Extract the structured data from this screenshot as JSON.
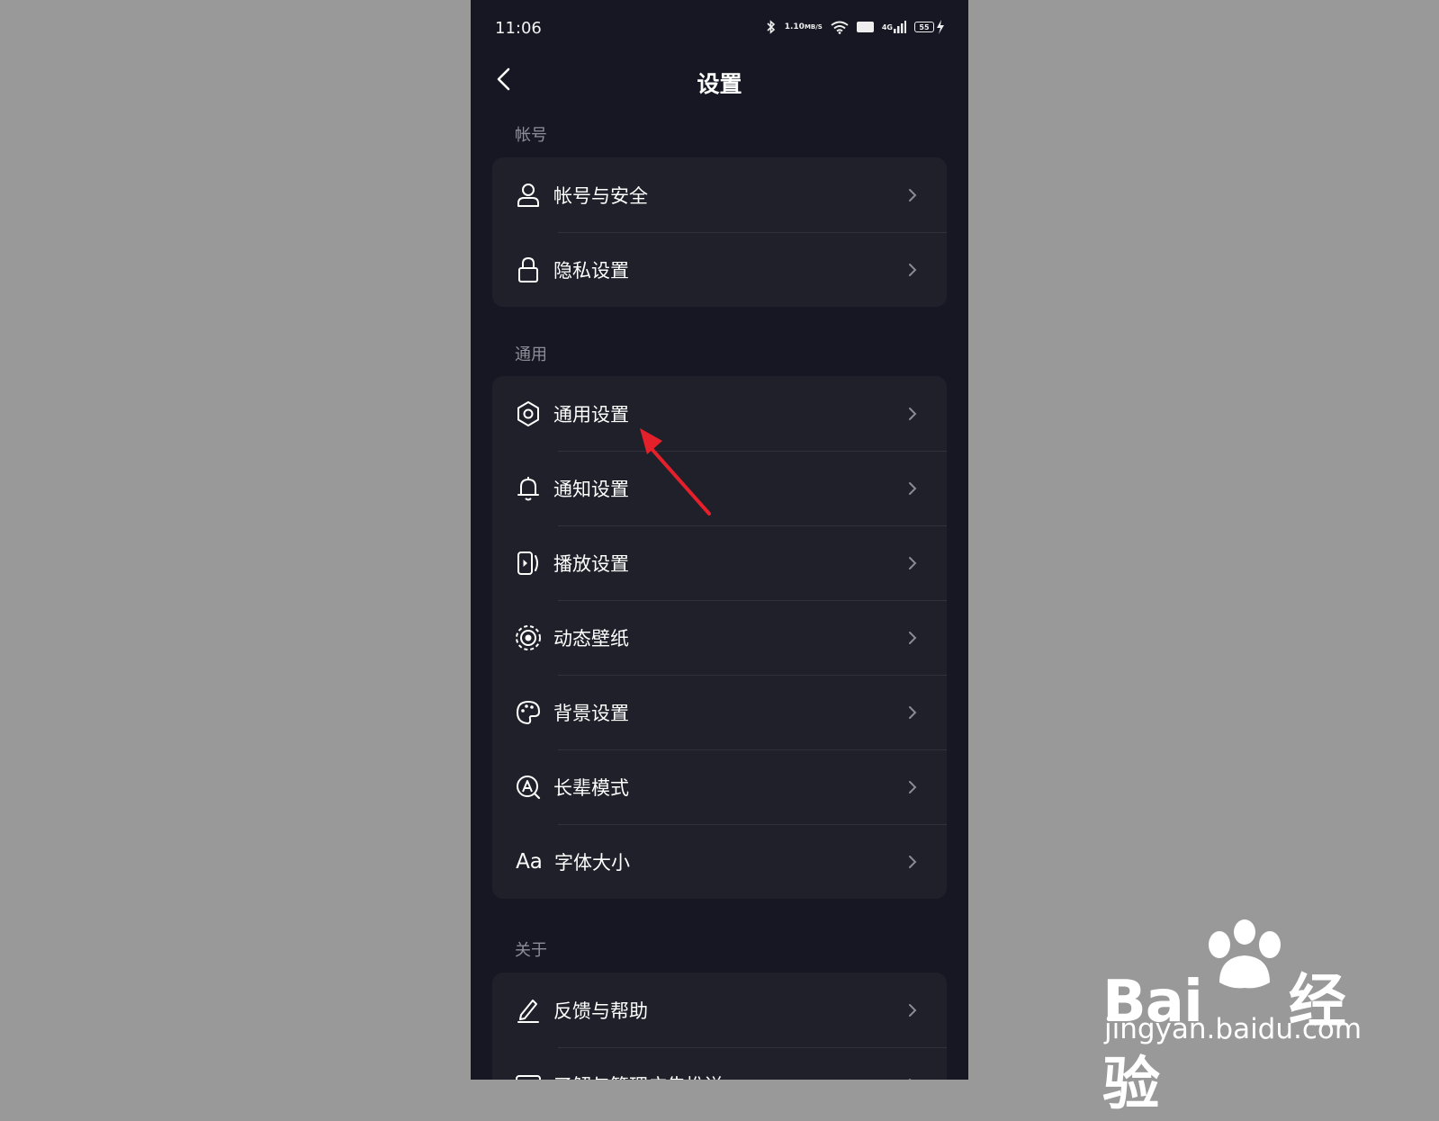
{
  "status_bar": {
    "time": "11:06",
    "net_speed_value": "1.10",
    "net_speed_unit": "MB/S",
    "hd": "HD",
    "signal_label": "4G",
    "battery": "55"
  },
  "header": {
    "title": "设置"
  },
  "sections": [
    {
      "label": "帐号",
      "items": [
        {
          "label": "帐号与安全",
          "icon": "user-icon"
        },
        {
          "label": "隐私设置",
          "icon": "lock-icon"
        }
      ]
    },
    {
      "label": "通用",
      "items": [
        {
          "label": "通用设置",
          "icon": "gear-icon"
        },
        {
          "label": "通知设置",
          "icon": "bell-icon"
        },
        {
          "label": "播放设置",
          "icon": "play-phone-icon"
        },
        {
          "label": "动态壁纸",
          "icon": "dynamic-wallpaper-icon"
        },
        {
          "label": "背景设置",
          "icon": "palette-icon"
        },
        {
          "label": "长辈模式",
          "icon": "elder-mode-icon"
        },
        {
          "label": "字体大小",
          "icon": "font-size-icon",
          "icon_text": "Aa"
        }
      ]
    },
    {
      "label": "关于",
      "items": [
        {
          "label": "反馈与帮助",
          "icon": "pen-icon"
        },
        {
          "label": "了解与管理广告推送",
          "icon": "ad-icon"
        }
      ]
    }
  ],
  "annotation": {
    "color": "#e5202b",
    "target": "通用设置"
  },
  "watermark": {
    "logo_text": "Bai",
    "logo_suffix": "经验",
    "url": "jingyan.baidu.com"
  },
  "colors": {
    "page_bg": "#999999",
    "phone_bg": "#161722",
    "card_bg": "#1f2029",
    "section_label": "#8d8e97"
  }
}
